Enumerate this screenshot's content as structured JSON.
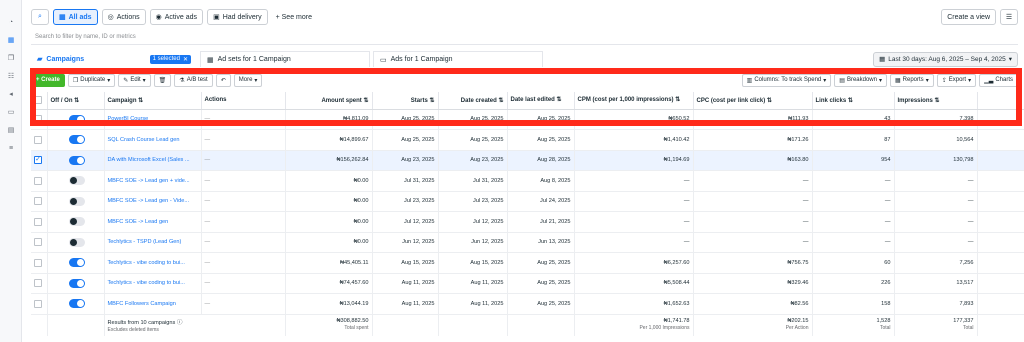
{
  "header": {
    "filters": {
      "all_ads": "All ads",
      "actions": "Actions",
      "active_ads": "Active ads",
      "had_delivery": "Had delivery",
      "see_more": "+ See more"
    },
    "create_view": "Create a view",
    "search_placeholder": "Search to filter by name, ID or metrics"
  },
  "tabs": {
    "campaigns": "Campaigns",
    "selected_badge": "1 selected",
    "ad_sets": "Ad sets for 1 Campaign",
    "ads": "Ads for 1 Campaign",
    "date_range": "Last 30 days: Aug 6, 2025 – Sep 4, 2025"
  },
  "toolbar": {
    "create": "+ Create",
    "duplicate": "Duplicate",
    "edit": "Edit",
    "ab_test": "A/B test",
    "more": "More",
    "columns": "Columns: To track Spend",
    "breakdown": "Breakdown",
    "reports": "Reports",
    "export": "Export",
    "charts": "Charts"
  },
  "table": {
    "headers": {
      "off_on": "Off / On ⇅",
      "campaign": "Campaign ⇅",
      "actions": "Actions",
      "amount_spent": "Amount spent ⇅",
      "starts": "Starts ⇅",
      "date_created": "Date created ⇅",
      "date_last_edited": "Date last edited ⇅",
      "cpm": "CPM (cost per 1,000 impressions) ⇅",
      "cpc": "CPC (cost per link click) ⇅",
      "link_clicks": "Link clicks ⇅",
      "impressions": "Impressions ⇅"
    },
    "rows": [
      {
        "on": true,
        "selected": false,
        "campaign": "PowerBI Course",
        "actions": "—",
        "spent": "₦4,811.09",
        "starts": "Aug 25, 2025",
        "created": "Aug 25, 2025",
        "edited": "Aug 25, 2025",
        "cpm": "₦650.52",
        "cpc": "₦111.93",
        "clicks": "43",
        "impressions": "7,398"
      },
      {
        "on": true,
        "selected": false,
        "campaign": "SQL Crash Course Lead gen",
        "actions": "—",
        "spent": "₦14,899.67",
        "starts": "Aug 25, 2025",
        "created": "Aug 25, 2025",
        "edited": "Aug 25, 2025",
        "cpm": "₦1,410.42",
        "cpc": "₦171.26",
        "clicks": "87",
        "impressions": "10,564"
      },
      {
        "on": true,
        "selected": true,
        "campaign": "DA with Microsoft Excel (Sales ...",
        "actions": "—",
        "spent": "₦156,262.84",
        "starts": "Aug 23, 2025",
        "created": "Aug 23, 2025",
        "edited": "Aug 28, 2025",
        "cpm": "₦1,194.69",
        "cpc": "₦163.80",
        "clicks": "954",
        "impressions": "130,798"
      },
      {
        "on": false,
        "selected": false,
        "campaign": "MBFC SOE -> Lead gen + vide...",
        "actions": "—",
        "spent": "₦0.00",
        "starts": "Jul 31, 2025",
        "created": "Jul 31, 2025",
        "edited": "Aug 8, 2025",
        "cpm": "—",
        "cpc": "—",
        "clicks": "—",
        "impressions": "—"
      },
      {
        "on": false,
        "selected": false,
        "campaign": "MBFC SOE -> Lead gen - Vide...",
        "actions": "—",
        "spent": "₦0.00",
        "starts": "Jul 23, 2025",
        "created": "Jul 23, 2025",
        "edited": "Jul 24, 2025",
        "cpm": "—",
        "cpc": "—",
        "clicks": "—",
        "impressions": "—"
      },
      {
        "on": false,
        "selected": false,
        "campaign": "MBFC SOE -> Lead gen",
        "actions": "—",
        "spent": "₦0.00",
        "starts": "Jul 12, 2025",
        "created": "Jul 12, 2025",
        "edited": "Jul 21, 2025",
        "cpm": "—",
        "cpc": "—",
        "clicks": "—",
        "impressions": "—"
      },
      {
        "on": false,
        "selected": false,
        "campaign": "Techlytics - TSPD (Lead Gen)",
        "actions": "—",
        "spent": "₦0.00",
        "starts": "Jun 12, 2025",
        "created": "Jun 12, 2025",
        "edited": "Jun 13, 2025",
        "cpm": "—",
        "cpc": "—",
        "clicks": "—",
        "impressions": "—"
      },
      {
        "on": true,
        "selected": false,
        "campaign": "Techlytics - vibe coding to bui...",
        "actions": "—",
        "spent": "₦45,405.11",
        "starts": "Aug 15, 2025",
        "created": "Aug 15, 2025",
        "edited": "Aug 25, 2025",
        "cpm": "₦6,257.60",
        "cpc": "₦756.75",
        "clicks": "60",
        "impressions": "7,256"
      },
      {
        "on": true,
        "selected": false,
        "campaign": "Techlytics - vibe coding to bui...",
        "actions": "—",
        "spent": "₦74,457.60",
        "starts": "Aug 11, 2025",
        "created": "Aug 11, 2025",
        "edited": "Aug 25, 2025",
        "cpm": "₦5,508.44",
        "cpc": "₦329.46",
        "clicks": "226",
        "impressions": "13,517"
      },
      {
        "on": true,
        "selected": false,
        "campaign": "MBFC Followers Campaign",
        "actions": "—",
        "spent": "₦13,044.19",
        "starts": "Aug 11, 2025",
        "created": "Aug 11, 2025",
        "edited": "Aug 25, 2025",
        "cpm": "₦1,652.63",
        "cpc": "₦82.56",
        "clicks": "158",
        "impressions": "7,893"
      }
    ],
    "footer": {
      "label": "Results from 10 campaigns",
      "note": "Excludes deleted items",
      "spent": "₦308,882.50",
      "spent_sub": "Total spent",
      "cpm": "₦1,741.78",
      "cpm_sub": "Per 1,000 Impressions",
      "cpc": "₦202.15",
      "cpc_sub": "Per Action",
      "clicks": "1,528",
      "clicks_sub": "Total",
      "impressions": "177,337",
      "impressions_sub": "Total"
    }
  },
  "colors": {
    "accent": "#1877f2",
    "highlight": "#ff2a1a",
    "create": "#42b72a"
  }
}
